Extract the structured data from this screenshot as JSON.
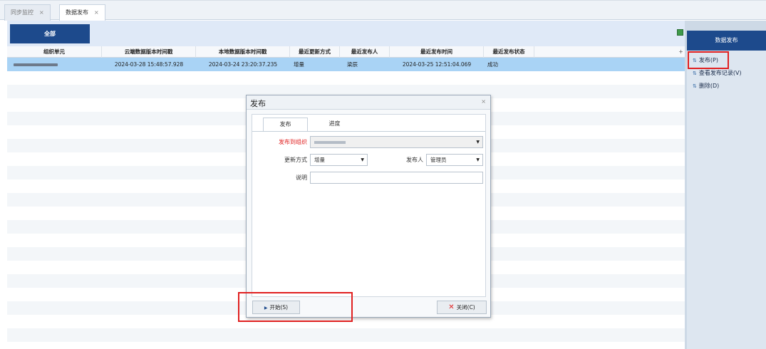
{
  "tabs": [
    {
      "label": "同步监控",
      "close": "×"
    },
    {
      "label": "数据发布",
      "close": "×"
    }
  ],
  "toolbar": {
    "all_button": "全部"
  },
  "grid": {
    "columns": [
      "组织单元",
      "云端数据版本时间戳",
      "本地数据版本时间戳",
      "最近更新方式",
      "最近发布人",
      "最近发布时间",
      "最近发布状态"
    ],
    "add_column": "+",
    "rows": [
      {
        "org": "",
        "cloud_ts": "2024-03-28 15:48:57.928",
        "local_ts": "2024-03-24 23:20:37.235",
        "update_mode": "增量",
        "publisher": "梁辰",
        "publish_time": "2024-03-25 12:51:04.069",
        "status": "成功"
      }
    ]
  },
  "right_panel": {
    "title": "数据发布",
    "items": [
      {
        "label": "发布(P)",
        "icon": "publish-icon"
      },
      {
        "label": "查看发布记录(V)",
        "icon": "record-icon"
      },
      {
        "label": "删除(D)",
        "icon": "delete-icon"
      }
    ]
  },
  "dialog": {
    "title": "发布",
    "close": "×",
    "tabs": [
      "发布",
      "进度"
    ],
    "fields": {
      "org_label": "发布到组织",
      "mode_label": "更新方式",
      "mode_value": "增量",
      "publisher_label": "发布人",
      "publisher_value": "管理员",
      "desc_label": "说明",
      "desc_value": ""
    },
    "start_button": "开始(S)",
    "close_button": "关闭(C)"
  },
  "colors": {
    "accent": "#1d4a8c",
    "selected_row": "#a9d3f5",
    "highlight": "#e02020"
  }
}
